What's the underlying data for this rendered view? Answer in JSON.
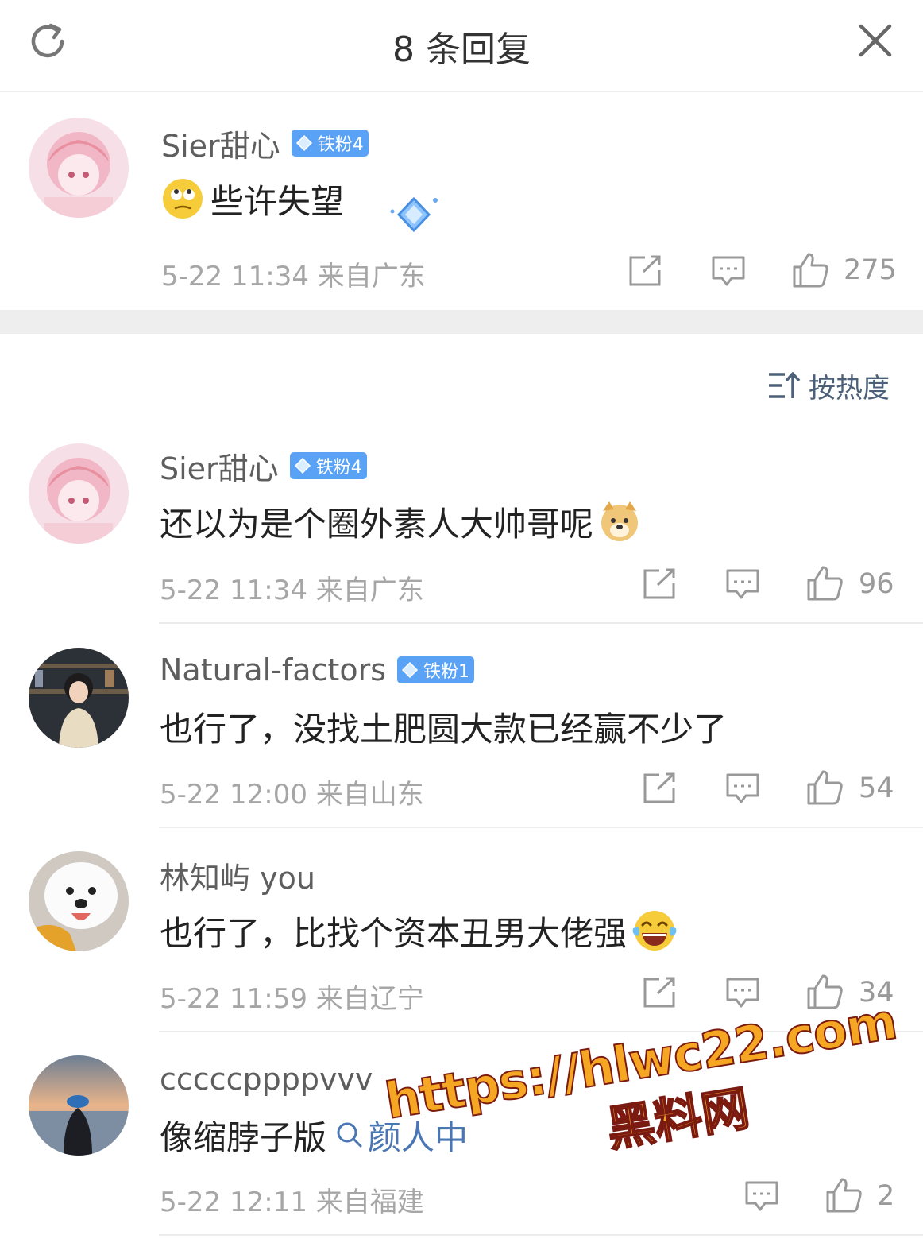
{
  "header": {
    "title": "8 条回复",
    "refresh_icon": "refresh-icon",
    "close_icon": "close-icon"
  },
  "root_comment": {
    "username": "Sier甜心",
    "badge": "铁粉4",
    "emoji": "rolling-eyes-emoji",
    "text": "些许失望",
    "meta": "5-22 11:34 来自广东",
    "likes": "275"
  },
  "sort": {
    "label": "按热度",
    "icon": "sort-icon"
  },
  "replies": [
    {
      "username": "Sier甜心",
      "badge": "铁粉4",
      "text": "还以为是个圈外素人大帅哥呢",
      "emoji": "doge-emoji",
      "meta": "5-22 11:34 来自广东",
      "likes": "96"
    },
    {
      "username": "Natural-factors",
      "badge": "铁粉1",
      "text": "也行了，没找土肥圆大款已经赢不少了",
      "meta": "5-22 12:00 来自山东",
      "likes": "54"
    },
    {
      "username": "林知屿 you",
      "text": "也行了，比找个资本丑男大佬强",
      "emoji": "laugh-crying-emoji",
      "meta": "5-22 11:59 来自辽宁",
      "likes": "34"
    },
    {
      "username": "cccccppppvvv",
      "text": "像缩脖子版",
      "link_text": "颜人中",
      "meta": "5-22 12:11 来自福建",
      "likes": "2"
    }
  ],
  "watermark": {
    "url": "https://hlwc22.com",
    "name": "黑料网"
  },
  "colors": {
    "badge": "#5aa2f5",
    "link": "#4a77b4",
    "divider": "#ececec",
    "meta": "#a6a6a6"
  }
}
